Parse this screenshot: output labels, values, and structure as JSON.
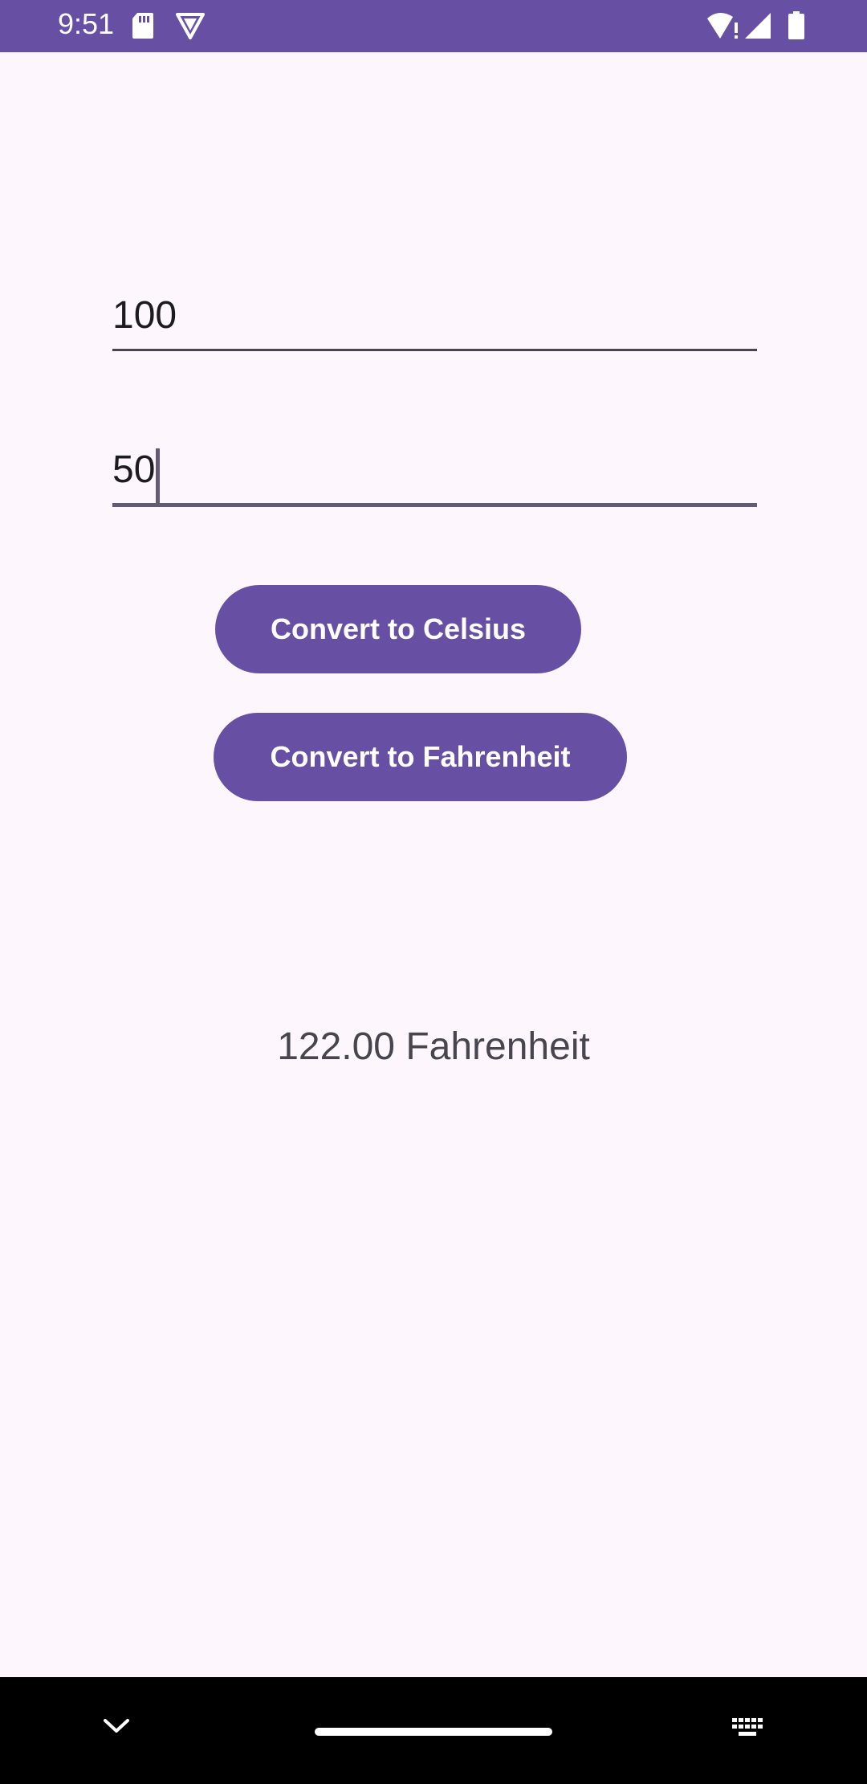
{
  "status_bar": {
    "time": "9:51",
    "background_color": "#6750a4",
    "icons": [
      "sd-card-icon",
      "vpn-shield-icon",
      "wifi-alert-icon",
      "cellular-signal-icon",
      "battery-icon"
    ]
  },
  "form": {
    "field1": {
      "value": "100"
    },
    "field2": {
      "value": "50",
      "focused": true
    }
  },
  "buttons": {
    "celsius_label": "Convert to Celsius",
    "fahrenheit_label": "Convert to Fahrenheit",
    "color": "#6750a4"
  },
  "result": {
    "text": "122.00 Fahrenheit"
  },
  "nav_bar": {
    "icons": [
      "collapse-keyboard-icon",
      "home-handle",
      "keyboard-icon"
    ]
  }
}
